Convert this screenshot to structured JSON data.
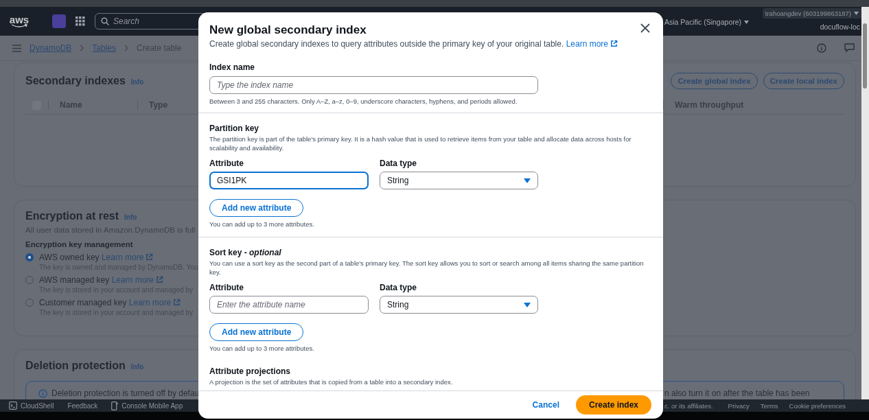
{
  "top_nav": {
    "logo": "aws",
    "search": {
      "placeholder": "Search"
    },
    "region": "Asia Pacific (Singapore)",
    "account": "trahoangdev (603199863187)",
    "project": "docuflow-loc"
  },
  "breadcrumbs": [
    {
      "label": "DynamoDB",
      "link": true
    },
    {
      "label": "Tables",
      "link": true
    },
    {
      "label": "Create table",
      "link": false
    }
  ],
  "secondary_indexes": {
    "title": "Secondary indexes",
    "info": "Info",
    "buttons": [
      "Create global index",
      "Create local index"
    ],
    "select_all": {
      "checked": false
    },
    "columns": [
      {
        "label": "Name"
      },
      {
        "label": "Type"
      },
      {
        "label": "Warm throughput"
      }
    ]
  },
  "encryption": {
    "title": "Encryption at rest",
    "info": "Info",
    "description": "All user data stored in Amazon DynamoDB is full",
    "group_label": "Encryption key management",
    "options": [
      {
        "label": "AWS owned key",
        "link": "Learn more",
        "description": "The key is owned and managed by DynamoDB. You",
        "selected": true
      },
      {
        "label": "AWS managed key",
        "link": "Learn more",
        "description": "The key is stored in your account and managed by",
        "selected": false
      },
      {
        "label": "Customer managed key",
        "link": "Learn more",
        "description": "The key is stored in your account and managed by",
        "selected": false
      }
    ]
  },
  "deletion_protection": {
    "title": "Deletion protection",
    "info": "Info",
    "alert_left": "Deletion protection is turned off by defau",
    "alert_right": "n also turn it on after the table has been"
  },
  "footer": {
    "left": [
      {
        "label": "CloudShell",
        "kind": "terminal"
      },
      {
        "label": "Feedback",
        "kind": "plain"
      },
      {
        "label": "Console Mobile App",
        "kind": "phone"
      }
    ],
    "copyright": "c. or its affiliates.",
    "links": [
      "Privacy",
      "Terms",
      "Cookie preferences"
    ]
  },
  "modal": {
    "title": "New global secondary index",
    "description": "Create global secondary indexes to query attributes outside the primary key of your original table.",
    "learn_more": "Learn more",
    "index_name": {
      "label": "Index name",
      "placeholder": "Type the index name",
      "hint": "Between 3 and 255 characters. Only A–Z, a–z, 0–9, underscore characters, hyphens, and periods allowed."
    },
    "sections": [
      {
        "title": "Partition key",
        "description": "The partition key is part of the table's primary key. It is a hash value that is used to retrieve items from your table and allocate data across hosts for scalability and availability.",
        "attribute": {
          "label": "Attribute",
          "value": "GSI1PK",
          "focused": true
        },
        "data_type": {
          "label": "Data type",
          "value": "String"
        },
        "add_button": "Add new attribute",
        "add_hint": "You can add up to 3 more attributes."
      },
      {
        "title": "Sort key - *optional*",
        "description": "You can use a sort key as the second part of a table's primary key. The sort key allows you to sort or search among all items sharing the same partition key.",
        "attribute": {
          "label": "Attribute",
          "placeholder": "Enter the attribute name",
          "focused": false
        },
        "data_type": {
          "label": "Data type",
          "value": "String"
        },
        "add_button": "Add new attribute",
        "add_hint": "You can add up to 3 more attributes."
      }
    ],
    "projections": {
      "title": "Attribute projections",
      "description": "A projection is the set of attributes that is copied from a table into a secondary index."
    },
    "buttons": {
      "cancel": "Cancel",
      "create": "Create index"
    }
  }
}
